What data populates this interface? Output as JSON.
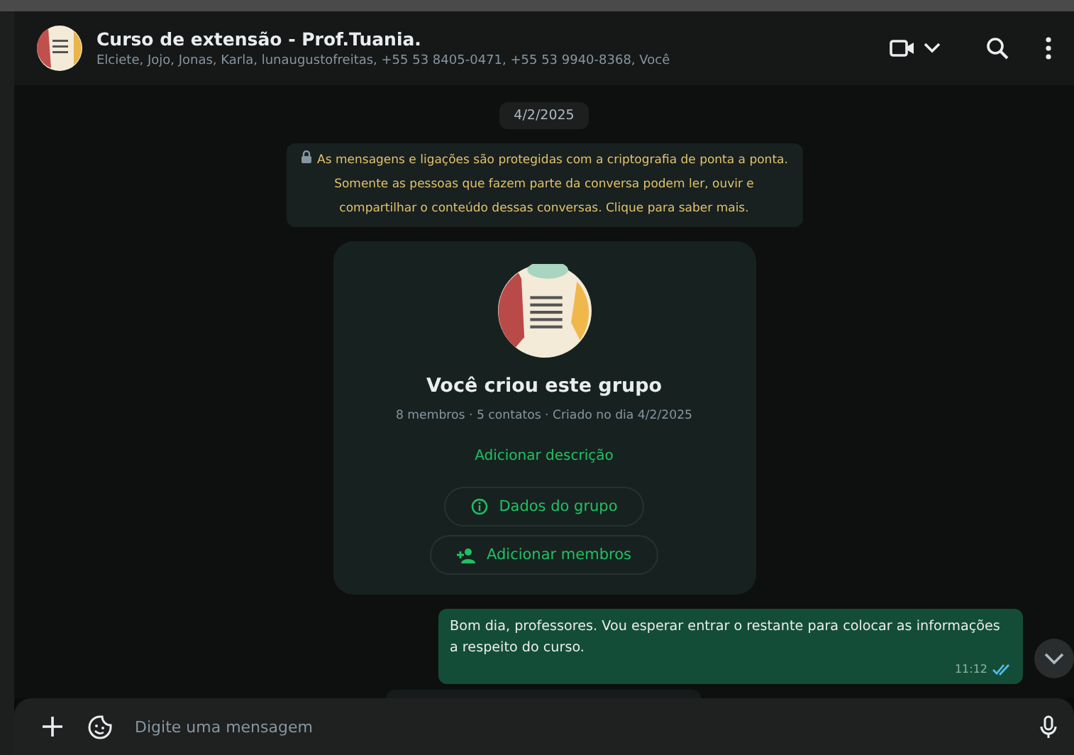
{
  "header": {
    "title": "Curso de extensão - Prof.Tuania.",
    "subtitle": "Elciete, Jojo, Jonas, Karla, lunaugustofreitas, +55 53 8405-0471, +55 53 9940-8368, Você"
  },
  "date_chip": "4/2/2025",
  "encryption_notice": "As mensagens e ligações são protegidas com a criptografia de ponta a ponta. Somente as pessoas que fazem parte da conversa podem ler, ouvir e compartilhar o conteúdo dessas conversas. Clique para saber mais.",
  "group_card": {
    "title": "Você criou este grupo",
    "meta": "8 membros · 5 contatos · Criado no dia 4/2/2025",
    "add_description": "Adicionar descrição",
    "buttons": [
      {
        "kind": "info",
        "label": "Dados do grupo"
      },
      {
        "kind": "add-member",
        "label": "Adicionar membros"
      }
    ]
  },
  "messages": [
    {
      "text": "Bom dia, professores. Vou esperar entrar o restante para colocar as informações a respeito do curso.",
      "time": "11:12",
      "read": true
    }
  ],
  "composer": {
    "placeholder": "Digite uma mensagem"
  }
}
